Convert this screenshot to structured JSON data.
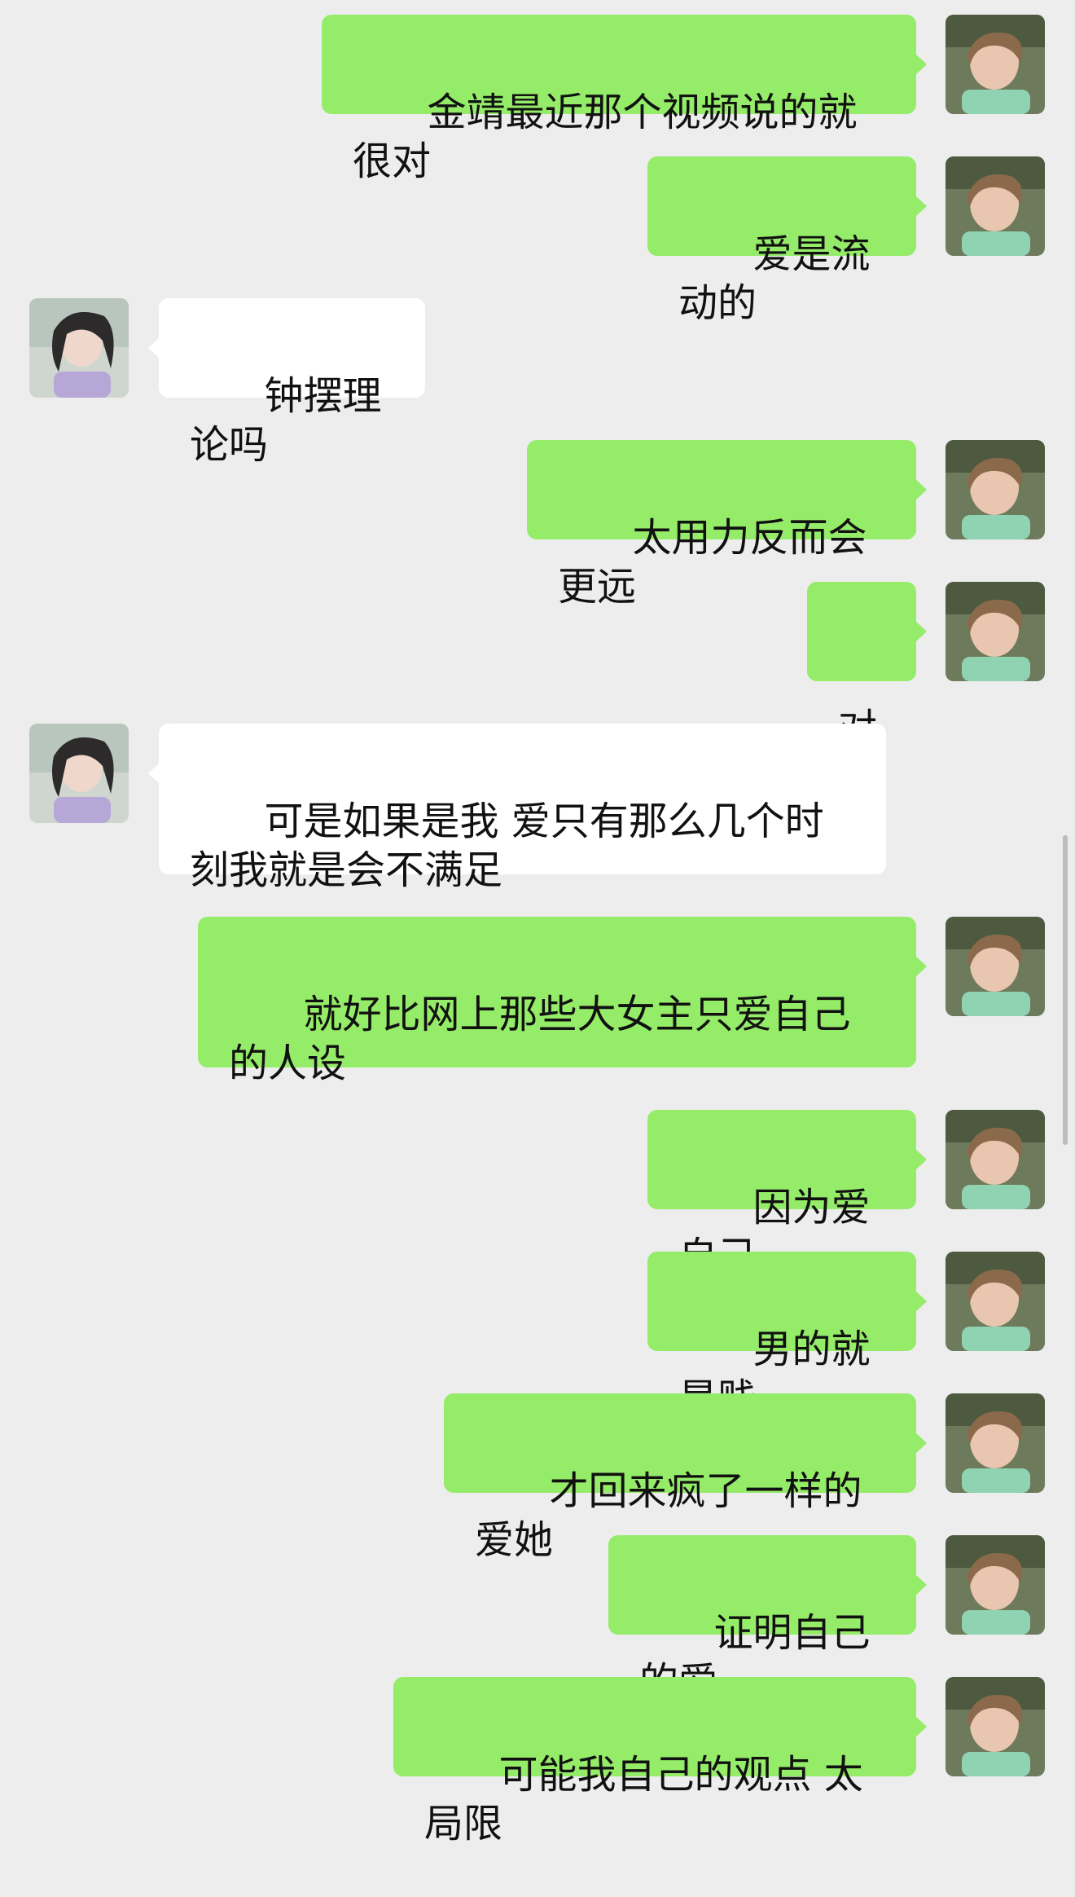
{
  "colors": {
    "background": "#ededed",
    "self_bubble": "#95ec69",
    "other_bubble": "#ffffff",
    "text": "#111111"
  },
  "messages": [
    {
      "from": "self",
      "text": "金靖最近那个视频说的就很对"
    },
    {
      "from": "self",
      "text": "爱是流动的"
    },
    {
      "from": "other",
      "text": "钟摆理论吗"
    },
    {
      "from": "self",
      "text": "太用力反而会更远"
    },
    {
      "from": "self",
      "text": "对"
    },
    {
      "from": "other",
      "text": "可是如果是我 爱只有那么几个时刻我就是会不满足"
    },
    {
      "from": "self",
      "text": "就好比网上那些大女主只爱自己的人设"
    },
    {
      "from": "self",
      "text": "因为爱自己"
    },
    {
      "from": "self",
      "text": "男的就是贱"
    },
    {
      "from": "self",
      "text": "才回来疯了一样的爱她"
    },
    {
      "from": "self",
      "text": "证明自己的爱"
    },
    {
      "from": "self",
      "text": "可能我自己的观点 太局限"
    }
  ],
  "avatars": {
    "self": "self-avatar-photo",
    "other": "other-avatar-photo"
  }
}
